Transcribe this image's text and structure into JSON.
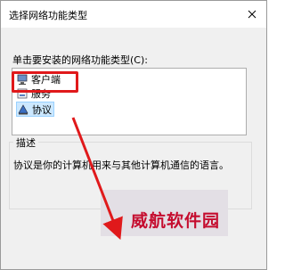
{
  "window": {
    "title": "选择网络功能类型"
  },
  "prompt": "单击要安装的网络功能类型(C):",
  "list": {
    "items": [
      {
        "label": "客户端",
        "icon": "client-icon"
      },
      {
        "label": "服务",
        "icon": "service-icon"
      },
      {
        "label": "协议",
        "icon": "protocol-icon",
        "selected": true
      }
    ]
  },
  "description": {
    "legend": "描述",
    "text": "协议是你的计算机用来与其他计算机通信的语言。"
  },
  "watermark": "威航软件园",
  "colors": {
    "highlight": "#e0191b",
    "selection": "#cce8ff",
    "watermark": "#c50d2f"
  }
}
